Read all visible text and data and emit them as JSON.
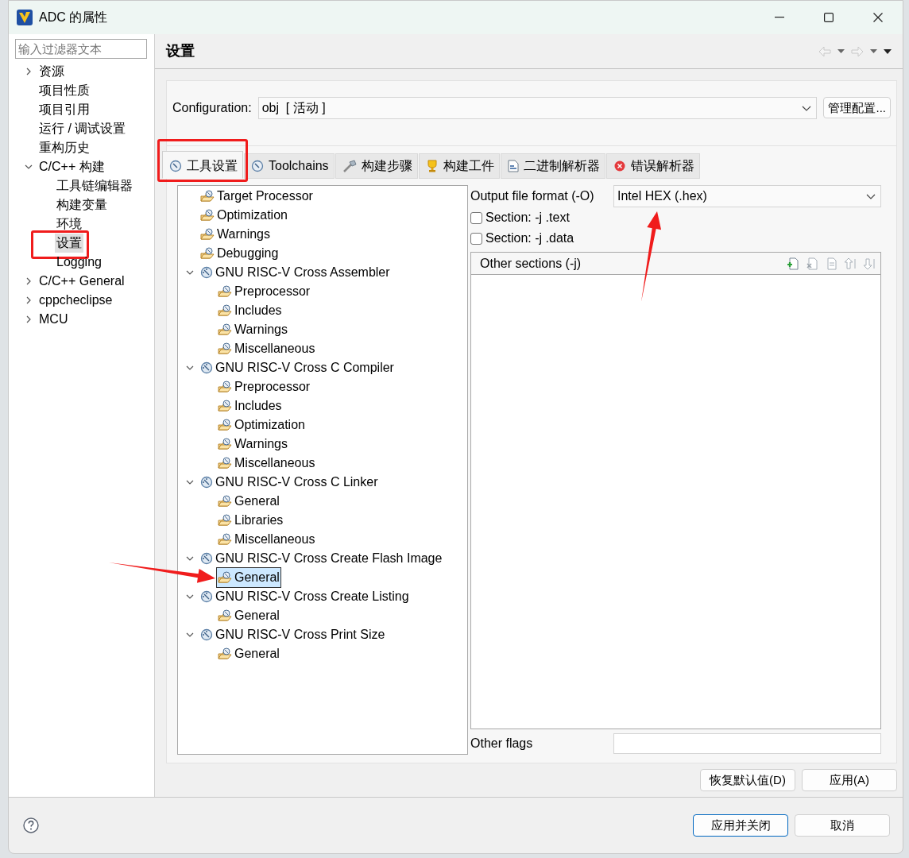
{
  "window": {
    "title": "ADC 的属性"
  },
  "filter": {
    "placeholder": "输入过滤器文本"
  },
  "sidebar": {
    "items": [
      {
        "label": "资源",
        "expanded": false,
        "selected": false
      },
      {
        "label": "项目性质",
        "selected": false
      },
      {
        "label": "项目引用",
        "selected": false
      },
      {
        "label": "运行 / 调试设置",
        "selected": false
      },
      {
        "label": "重构历史",
        "selected": false
      },
      {
        "label": "C/C++ 构建",
        "expanded": true,
        "selected": false,
        "children": [
          {
            "label": "工具链编辑器",
            "selected": false
          },
          {
            "label": "构建变量",
            "selected": false
          },
          {
            "label": "环境",
            "selected": false
          },
          {
            "label": "设置",
            "selected": true,
            "annotated": true
          },
          {
            "label": "Logging",
            "selected": false
          }
        ]
      },
      {
        "label": "C/C++ General",
        "expanded": false,
        "selected": false
      },
      {
        "label": "cppcheclipse",
        "expanded": false,
        "selected": false
      },
      {
        "label": "MCU",
        "expanded": false,
        "selected": false
      }
    ]
  },
  "page": {
    "title": "设置"
  },
  "configuration": {
    "label": "Configuration:",
    "value": "obj  [ 活动 ]",
    "button": "管理配置..."
  },
  "tabs": [
    {
      "label": "工具设置",
      "kind": "tool",
      "selected": true,
      "annotated": true
    },
    {
      "label": "Toolchains",
      "kind": "toolchain",
      "selected": false
    },
    {
      "label": "构建步骤",
      "kind": "steps",
      "selected": false
    },
    {
      "label": "构建工件",
      "kind": "artifact",
      "selected": false
    },
    {
      "label": "二进制解析器",
      "kind": "binary",
      "selected": false
    },
    {
      "label": "错误解析器",
      "kind": "error",
      "selected": false
    }
  ],
  "tool_tree": [
    {
      "label": "Target Processor",
      "kind": "option",
      "selected": false
    },
    {
      "label": "Optimization",
      "kind": "option",
      "selected": false
    },
    {
      "label": "Warnings",
      "kind": "option",
      "selected": false
    },
    {
      "label": "Debugging",
      "kind": "option",
      "selected": false
    },
    {
      "label": "GNU RISC-V Cross Assembler",
      "kind": "tool",
      "expanded": true,
      "selected": false,
      "children": [
        {
          "label": "Preprocessor",
          "kind": "option",
          "selected": false
        },
        {
          "label": "Includes",
          "kind": "option",
          "selected": false
        },
        {
          "label": "Warnings",
          "kind": "option",
          "selected": false
        },
        {
          "label": "Miscellaneous",
          "kind": "option",
          "selected": false
        }
      ]
    },
    {
      "label": "GNU RISC-V Cross C Compiler",
      "kind": "tool",
      "expanded": true,
      "selected": false,
      "children": [
        {
          "label": "Preprocessor",
          "kind": "option",
          "selected": false
        },
        {
          "label": "Includes",
          "kind": "option",
          "selected": false
        },
        {
          "label": "Optimization",
          "kind": "option",
          "selected": false
        },
        {
          "label": "Warnings",
          "kind": "option",
          "selected": false
        },
        {
          "label": "Miscellaneous",
          "kind": "option",
          "selected": false
        }
      ]
    },
    {
      "label": "GNU RISC-V Cross C Linker",
      "kind": "tool",
      "expanded": true,
      "selected": false,
      "children": [
        {
          "label": "General",
          "kind": "option",
          "selected": false
        },
        {
          "label": "Libraries",
          "kind": "option",
          "selected": false
        },
        {
          "label": "Miscellaneous",
          "kind": "option",
          "selected": false
        }
      ]
    },
    {
      "label": "GNU RISC-V Cross Create Flash Image",
      "kind": "tool",
      "expanded": true,
      "selected": false,
      "children": [
        {
          "label": "General",
          "kind": "option",
          "selected": true,
          "arrow": true
        }
      ]
    },
    {
      "label": "GNU RISC-V Cross Create Listing",
      "kind": "tool",
      "expanded": true,
      "selected": false,
      "children": [
        {
          "label": "General",
          "kind": "option",
          "selected": false
        }
      ]
    },
    {
      "label": "GNU RISC-V Cross Print Size",
      "kind": "tool",
      "expanded": true,
      "selected": false,
      "children": [
        {
          "label": "General",
          "kind": "option",
          "selected": false
        }
      ]
    }
  ],
  "options": {
    "output_format": {
      "label": "Output file format (-O)",
      "value": "Intel HEX (.hex)",
      "arrow": true
    },
    "checkboxes": [
      {
        "label": "Section: -j .text",
        "checked": false
      },
      {
        "label": "Section: -j .data",
        "checked": false
      }
    ],
    "other_sections": {
      "title": "Other sections (-j)"
    },
    "other_flags": {
      "label": "Other flags"
    }
  },
  "buttons": {
    "restore": "恢复默认值(D)",
    "apply": "应用(A)",
    "apply_close": "应用并关闭",
    "cancel": "取消"
  }
}
